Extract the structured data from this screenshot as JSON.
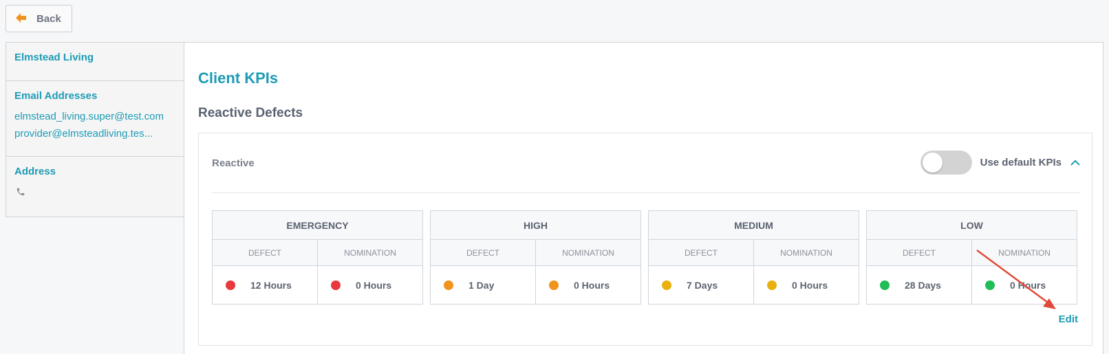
{
  "header": {
    "back_label": "Back",
    "accent": "#f0941d"
  },
  "sidebar": {
    "client_name": "Elmstead Living",
    "email_title": "Email Addresses",
    "emails": [
      "elmstead_living.super@test.com",
      "provider@elmsteadliving.tes..."
    ],
    "address_title": "Address",
    "address_icon": "phone-icon"
  },
  "main": {
    "page_title": "Client KPIs",
    "section_title": "Reactive Defects",
    "card": {
      "label": "Reactive",
      "toggle_label": "Use default KPIs",
      "toggle_on": false,
      "edit_label": "Edit",
      "sub_headers": [
        "DEFECT",
        "NOMINATION"
      ],
      "priorities": [
        {
          "name": "EMERGENCY",
          "color": "#e8393f",
          "defect": "12 Hours",
          "nomination": "0 Hours"
        },
        {
          "name": "HIGH",
          "color": "#f0941d",
          "defect": "1 Day",
          "nomination": "0 Hours"
        },
        {
          "name": "MEDIUM",
          "color": "#e9b10e",
          "defect": "7 Days",
          "nomination": "0 Hours"
        },
        {
          "name": "LOW",
          "color": "#21bd57",
          "defect": "28 Days",
          "nomination": "0 Hours"
        }
      ]
    }
  },
  "colors": {
    "brand": "#1d9bb5",
    "annotation_arrow": "#e04a3a"
  }
}
